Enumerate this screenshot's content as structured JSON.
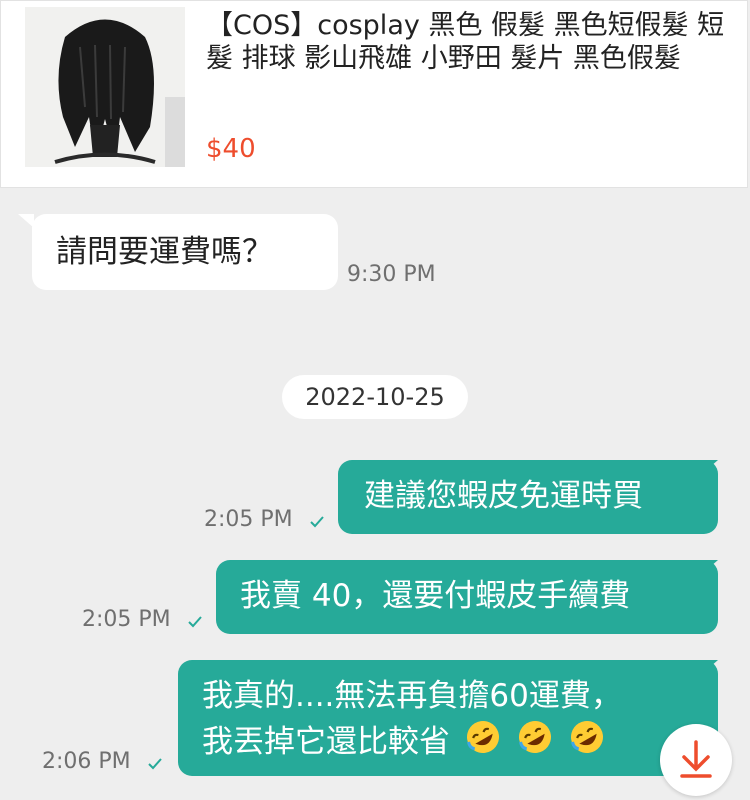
{
  "product": {
    "title": "【COS】cosplay 黑色 假髮 黑色短假髮 短髮 排球 影山飛雄 小野田 髮片 黑色假髮",
    "price": "$40"
  },
  "messages": [
    {
      "text": "請問要運費嗎？",
      "time": "9:30 PM"
    }
  ],
  "date_divider": "2022-10-25",
  "outgoing": [
    {
      "text": "建議您蝦皮免運時買",
      "time": "2:05 PM"
    },
    {
      "text": "我賣 40，還要付蝦皮手續費",
      "time": "2:05 PM"
    },
    {
      "line1": "我真的....無法再負擔60運費，",
      "line2": "我丟掉它還比較省",
      "time": "2:06 PM"
    }
  ],
  "colors": {
    "accent": "#26aa99",
    "price": "#ee4d2d",
    "scroll_arrow": "#ee4d2d"
  },
  "icons": {
    "read": "check-icon",
    "emoji": "rolling-on-floor-laughing-emoji",
    "scroll": "arrow-down-icon"
  }
}
